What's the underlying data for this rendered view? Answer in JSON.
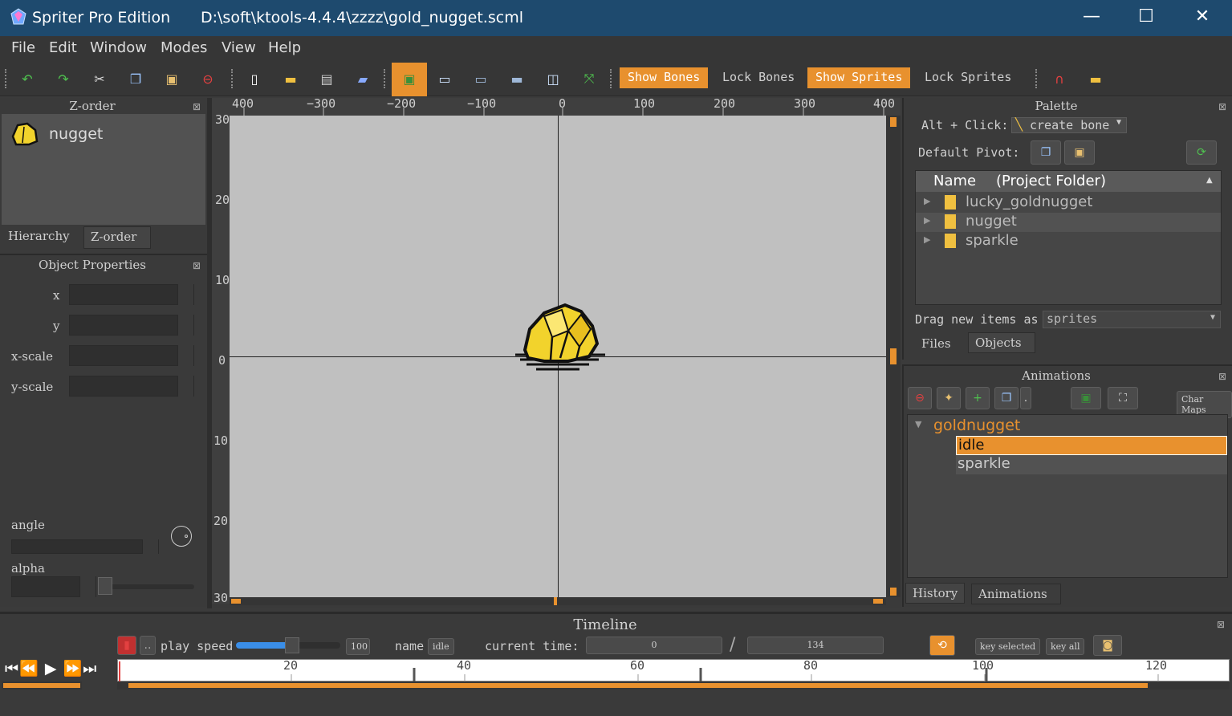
{
  "window": {
    "app_title": "Spriter Pro Edition",
    "file_path": "D:\\soft\\ktools-4.4.4\\zzzz\\gold_nugget.scml",
    "min": "—",
    "max": "☐",
    "close": "✕"
  },
  "menu": [
    "File",
    "Edit",
    "Window",
    "Modes",
    "View",
    "Help"
  ],
  "toolbar": {
    "show_bones": "Show Bones",
    "lock_bones": "Lock Bones",
    "show_sprites": "Show Sprites",
    "lock_sprites": "Lock Sprites"
  },
  "zorder": {
    "title": "Z-order",
    "items": [
      {
        "name": "nugget"
      }
    ],
    "tabs": [
      "Hierarchy",
      "Z-order"
    ]
  },
  "object_properties": {
    "title": "Object Properties",
    "labels": {
      "x": "x",
      "y": "y",
      "x_scale": "x-scale",
      "y_scale": "y-scale",
      "angle": "angle",
      "alpha": "alpha"
    }
  },
  "canvas": {
    "ruler_x": [
      "400",
      "−300",
      "−200",
      "−100",
      "0",
      "100",
      "200",
      "300",
      "400"
    ],
    "ruler_y": [
      "30",
      "20",
      "10",
      "0",
      "10",
      "20",
      "30"
    ]
  },
  "palette": {
    "title": "Palette",
    "alt_click_label": "Alt + Click:",
    "alt_click_value": "create bone",
    "default_pivot_label": "Default Pivot:",
    "header_name": "Name",
    "header_folder": "(Project Folder)",
    "folders": [
      "lucky_goldnugget",
      "nugget",
      "sparkle"
    ],
    "drag_label": "Drag new items as",
    "drag_value": "sprites",
    "tabs": [
      "Files",
      "Objects"
    ]
  },
  "animations": {
    "title": "Animations",
    "char_maps": "Char Maps",
    "entity": "goldnugget",
    "items": [
      "idle",
      "sparkle"
    ],
    "tabs": [
      "History",
      "Animations"
    ]
  },
  "timeline": {
    "title": "Timeline",
    "play_speed_label": "play speed",
    "play_speed_value": "100",
    "play_speed_fraction": 0.5,
    "name_label": "name",
    "name_value": "idle",
    "current_time_label": "current time:",
    "current_time": "0",
    "slash": "/",
    "length": "134",
    "key_selected": "key selected",
    "key_all": "key all",
    "ticks": [
      "20",
      "40",
      "60",
      "80",
      "100",
      "120"
    ]
  },
  "colors": {
    "accent": "#e8912e",
    "titlebar": "#1e4a6e",
    "canvas": "#c0c0c0"
  }
}
